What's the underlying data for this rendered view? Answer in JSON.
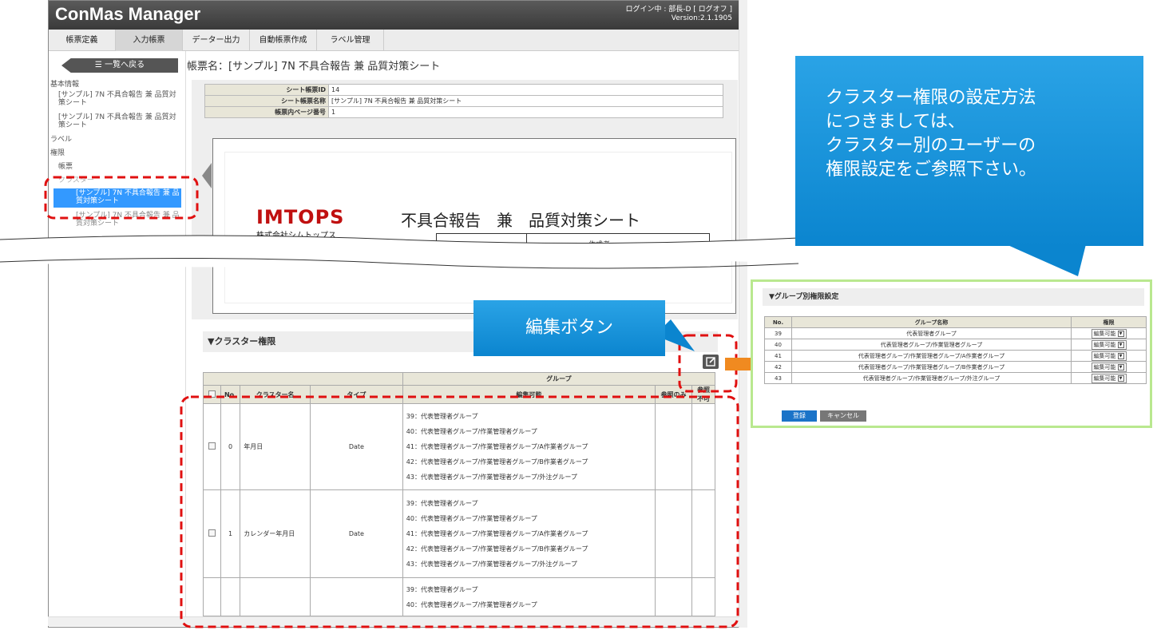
{
  "app": {
    "title": "ConMas Manager",
    "login_label": "ログイン中 : 部長-D [ ログオフ ]",
    "version": "Version:2.1.1905"
  },
  "nav": {
    "tabs": [
      "帳票定義",
      "入力帳票",
      "データー出力",
      "自動帳票作成",
      "ラベル管理"
    ]
  },
  "sidebar": {
    "back_label": "一覧へ戻る",
    "basic_info": "基本情報",
    "basic_item_1": "[サンプル] 7N 不具合報告 兼 品質対策シート",
    "basic_item_2": "[サンプル] 7N 不具合報告 兼 品質対策シート",
    "label": "ラベル",
    "permission": "権限",
    "form": "帳票",
    "cluster": "クラスター",
    "selected_item": "[サンプル] 7N 不具合報告 兼 品質対策シート",
    "next_item": "[サンプル] 7N 不具合報告 兼 品質対策シート"
  },
  "content": {
    "sheet_title": "帳票名：[サンプル] 7N 不具合報告 兼 品質対策シート",
    "info_rows": [
      {
        "label": "シート帳票ID",
        "value": "14"
      },
      {
        "label": "シート帳票名称",
        "value": "[サンプル] 7N 不具合報告 兼 品質対策シート"
      },
      {
        "label": "帳票内ページ番号",
        "value": "1"
      }
    ],
    "preview": {
      "logo_text": "IMTOPS",
      "company": "株式会社シムトップス",
      "doc_title": "不具合報告　兼　品質対策シート",
      "author_label": "作成者"
    },
    "cluster_section": "▼クラスター権限",
    "cluster_table": {
      "group_header": "グループ",
      "headers": [
        "No.",
        "クラスター名",
        "タイプ",
        "編集可能",
        "参照のみ",
        "参照不可"
      ],
      "rows": [
        {
          "no": "0",
          "name": "年月日",
          "type": "Date",
          "groups": [
            "39：代表管理者グループ",
            "40：代表管理者グループ/作業管理者グループ",
            "41：代表管理者グループ/作業管理者グループ/A作業者グループ",
            "42：代表管理者グループ/作業管理者グループ/B作業者グループ",
            "43：代表管理者グループ/作業管理者グループ/外注グループ"
          ]
        },
        {
          "no": "1",
          "name": "カレンダー年月日",
          "type": "Date",
          "groups": [
            "39：代表管理者グループ",
            "40：代表管理者グループ/作業管理者グループ",
            "41：代表管理者グループ/作業管理者グループ/A作業者グループ",
            "42：代表管理者グループ/作業管理者グループ/B作業者グループ",
            "43：代表管理者グループ/作業管理者グループ/外注グループ"
          ]
        },
        {
          "no": "",
          "name": "",
          "type": "",
          "groups": [
            "39：代表管理者グループ",
            "40：代表管理者グループ/作業管理者グループ"
          ]
        }
      ]
    }
  },
  "callouts": {
    "right": [
      "クラスター権限の設定方法",
      "につきましては、",
      "クラスター別のユーザーの",
      "権限設定をご参照下さい。"
    ],
    "edit": "編集ボタン"
  },
  "group_panel": {
    "title": "▼グループ別権限設定",
    "headers": [
      "No.",
      "グループ名称",
      "権限"
    ],
    "rows": [
      {
        "no": "39",
        "name": "代表管理者グループ",
        "perm": "編集可能"
      },
      {
        "no": "40",
        "name": "代表管理者グループ/作業管理者グループ",
        "perm": "編集可能"
      },
      {
        "no": "41",
        "name": "代表管理者グループ/作業管理者グループ/A作業者グループ",
        "perm": "編集可能"
      },
      {
        "no": "42",
        "name": "代表管理者グループ/作業管理者グループ/B作業者グループ",
        "perm": "編集可能"
      },
      {
        "no": "43",
        "name": "代表管理者グループ/作業管理者グループ/外注グループ",
        "perm": "編集可能"
      }
    ],
    "register_label": "登録",
    "cancel_label": "キャンセル"
  },
  "colors": {
    "accent_red": "#e01010",
    "callout_blue": "#1a95dc",
    "arrow_orange": "#f08a20",
    "panel_green": "#b9e88f"
  }
}
